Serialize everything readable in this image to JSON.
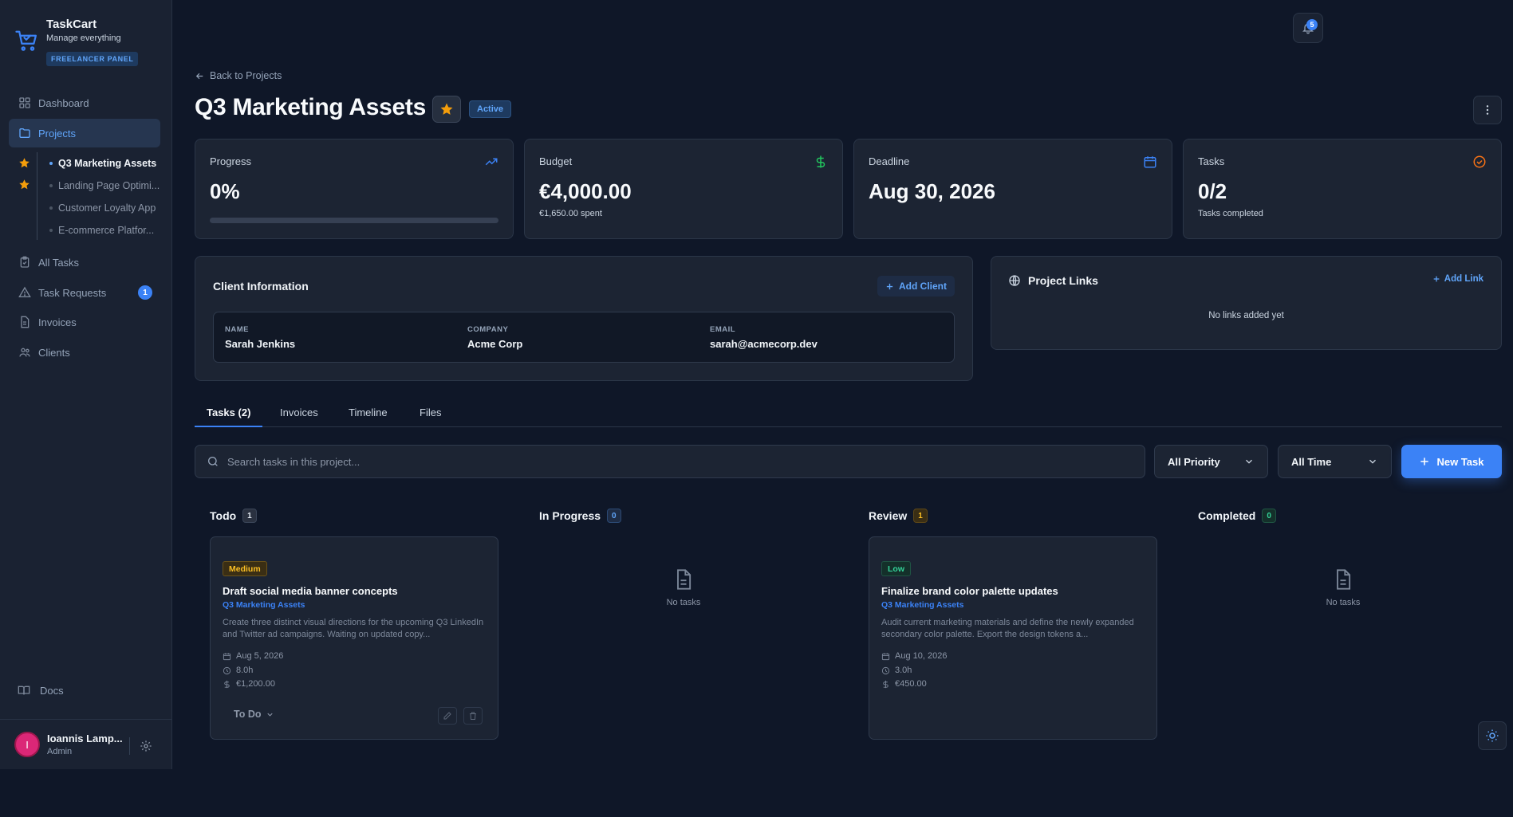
{
  "brand": {
    "name": "TaskCart",
    "tagline": "Manage everything",
    "badge": "FREELANCER PANEL",
    "icon": "cart-icon"
  },
  "sidebar": {
    "items": [
      {
        "label": "Dashboard",
        "icon": "grid-icon"
      },
      {
        "label": "Projects",
        "icon": "folder-icon",
        "active": true
      },
      {
        "label": "All Tasks",
        "icon": "clipboard-icon"
      },
      {
        "label": "Task Requests",
        "icon": "alert-triangle-icon",
        "badge": "1"
      },
      {
        "label": "Invoices",
        "icon": "file-icon"
      },
      {
        "label": "Clients",
        "icon": "users-icon"
      }
    ],
    "projects": [
      {
        "label": "Q3 Marketing Assets",
        "starred": true,
        "active": true
      },
      {
        "label": "Landing Page Optimi...",
        "starred": true
      },
      {
        "label": "Customer Loyalty App",
        "starred": false
      },
      {
        "label": "E-commerce Platfor...",
        "starred": false
      }
    ],
    "docs": "Docs"
  },
  "user": {
    "initial": "I",
    "name": "Ioannis Lamp...",
    "role": "Admin"
  },
  "header": {
    "notifications": "5"
  },
  "project": {
    "back": "Back to Projects",
    "title": "Q3 Marketing Assets",
    "status": "Active"
  },
  "stats": {
    "progress": {
      "label": "Progress",
      "value": "0%",
      "fraction": 0.0
    },
    "budget": {
      "label": "Budget",
      "value": "€4,000.00",
      "sub": "€1,650.00 spent"
    },
    "deadline": {
      "label": "Deadline",
      "value": "Aug 30, 2026"
    },
    "tasks": {
      "label": "Tasks",
      "value": "0/2",
      "sub": "Tasks completed"
    }
  },
  "client": {
    "title": "Client Information",
    "add": "Add Client",
    "name_label": "NAME",
    "name": "Sarah Jenkins",
    "company_label": "COMPANY",
    "company": "Acme Corp",
    "email_label": "EMAIL",
    "email": "sarah@acmecorp.dev"
  },
  "links": {
    "title": "Project Links",
    "add": "Add Link",
    "empty": "No links added yet"
  },
  "tabs": [
    "Tasks (2)",
    "Invoices",
    "Timeline",
    "Files"
  ],
  "filters": {
    "search_placeholder": "Search tasks in this project...",
    "priority": "All Priority",
    "time": "All Time",
    "new_task": "New Task"
  },
  "columns": [
    {
      "name": "Todo",
      "count": "1"
    },
    {
      "name": "In Progress",
      "count": "0"
    },
    {
      "name": "Review",
      "count": "1"
    },
    {
      "name": "Completed",
      "count": "0"
    }
  ],
  "empty_label": "No tasks",
  "tasks": [
    {
      "priority": "Medium",
      "title": "Draft social media banner concepts",
      "project": "Q3 Marketing Assets",
      "description": "Create three distinct visual directions for the upcoming Q3 LinkedIn and Twitter ad campaigns. Waiting on updated copy...",
      "date": "Aug 5, 2026",
      "hours": "8.0h",
      "amount": "€1,200.00",
      "status": "To Do"
    },
    {
      "priority": "Low",
      "title": "Finalize brand color palette updates",
      "project": "Q3 Marketing Assets",
      "description": "Audit current marketing materials and define the newly expanded secondary color palette. Export the design tokens a...",
      "date": "Aug 10, 2026",
      "hours": "3.0h",
      "amount": "€450.00"
    }
  ],
  "colors": {
    "accent": "#3b82f6",
    "star": "#f59e0b",
    "budget_icon": "#22c55e",
    "tasks_icon": "#f97316",
    "medium": "#f59e0b",
    "low": "#22c55e"
  }
}
